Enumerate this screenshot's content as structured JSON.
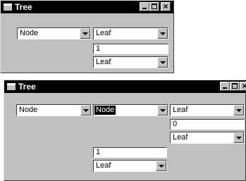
{
  "windows": [
    {
      "title": "Tree",
      "controls": {
        "minimize": "_",
        "maximize": "□",
        "close": "×"
      },
      "node_select": "Node",
      "leaf_select_top": "Leaf",
      "value_field": "1",
      "leaf_select_bottom": "Leaf"
    },
    {
      "title": "Tree",
      "controls": {
        "minimize": "_",
        "maximize": "□",
        "close": "×"
      },
      "node_select_left": "Node",
      "node_select_middle": "Node",
      "right_leaf_top": "Leaf",
      "right_value": "0",
      "right_leaf_bottom": "Leaf",
      "middle_value": "1",
      "middle_leaf": "Leaf"
    }
  ]
}
